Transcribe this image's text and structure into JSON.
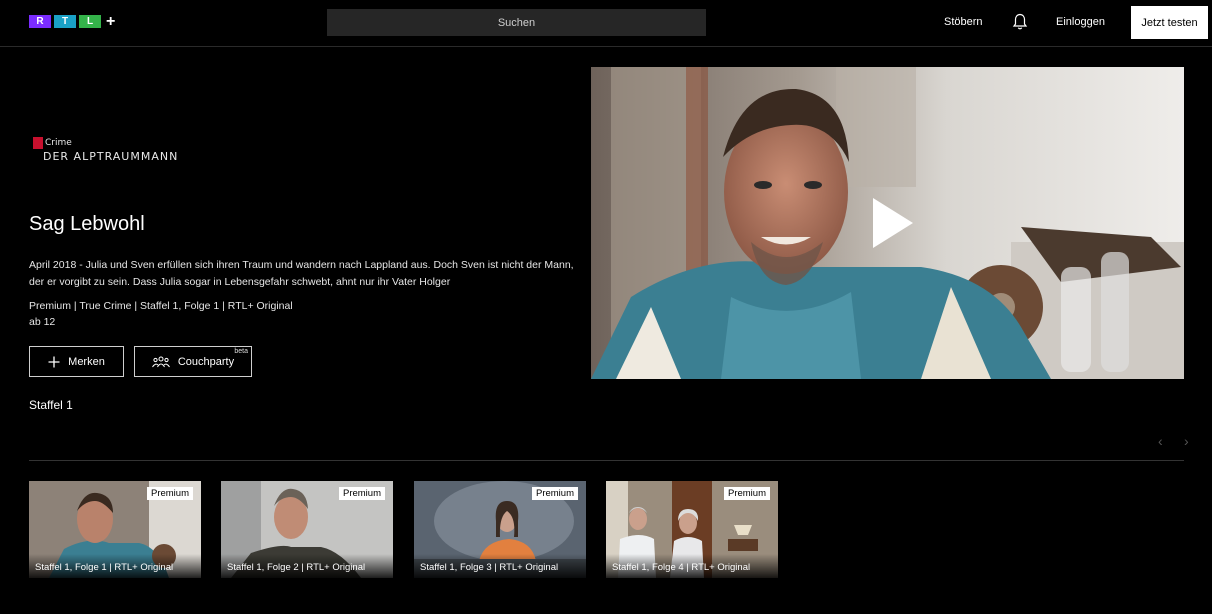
{
  "header": {
    "logo_letters": [
      "R",
      "T",
      "L"
    ],
    "logo_plus": "+",
    "logo_colors": [
      "#7b2cff",
      "#1aa1c6",
      "#34b34a"
    ],
    "search_placeholder": "Suchen",
    "nav_browse": "Stöbern",
    "nav_login": "Einloggen",
    "cta": "Jetzt testen"
  },
  "hero": {
    "brand_top": "Crime",
    "brand_show": "DER ALPTRAUMMANN",
    "title": "Sag Lebwohl",
    "description": "April 2018 - Julia und Sven erfüllen sich ihren Traum und wandern nach Lappland aus. Doch Sven ist nicht der Mann, der er vorgibt zu sein. Dass Julia sogar in Lebensgefahr schwebt, ahnt nur ihr Vater Holger",
    "meta": "Premium | True Crime | Staffel 1, Folge 1 | RTL+ Original",
    "age": "ab 12",
    "btn_save": "Merken",
    "btn_couch": "Couchparty",
    "beta": "beta"
  },
  "season": {
    "label": "Staffel 1"
  },
  "episodes": [
    {
      "label": "Staffel 1, Folge 1 | RTL+ Original",
      "badge": "Premium"
    },
    {
      "label": "Staffel 1, Folge 2 | RTL+ Original",
      "badge": "Premium"
    },
    {
      "label": "Staffel 1, Folge 3 | RTL+ Original",
      "badge": "Premium"
    },
    {
      "label": "Staffel 1, Folge 4 | RTL+ Original",
      "badge": "Premium"
    }
  ],
  "icons": [
    "bell-icon",
    "plus-icon",
    "group-icon",
    "play-icon",
    "chevron-left-icon",
    "chevron-right-icon"
  ]
}
